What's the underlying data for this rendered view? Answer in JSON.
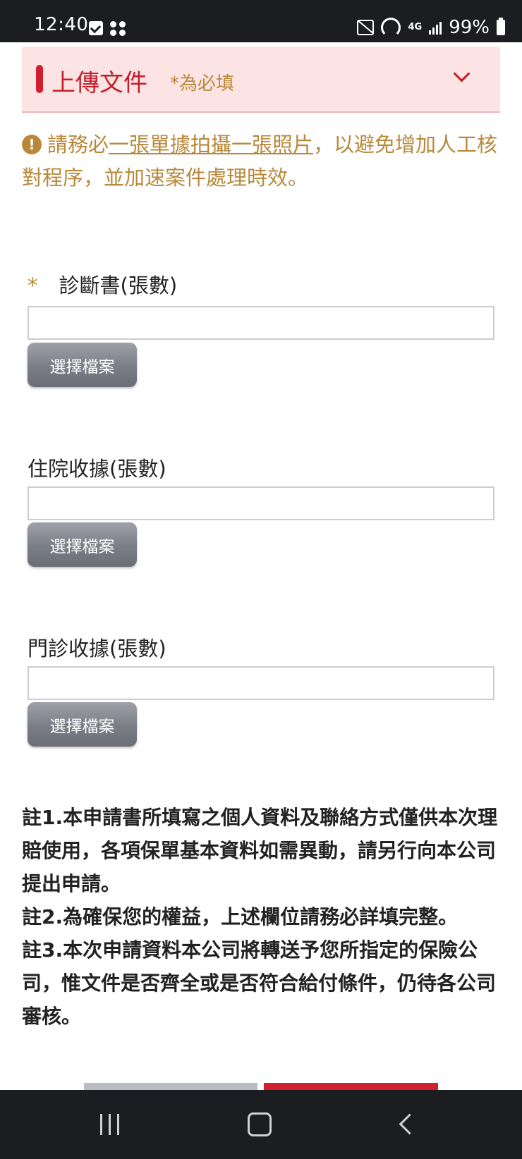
{
  "status_bar": {
    "time": "12:40",
    "network": "4G",
    "battery": "99%"
  },
  "section": {
    "title": "上傳文件",
    "required_note": "*為必填"
  },
  "notice": {
    "prefix": "請務必",
    "emphasis": "一張單據拍攝一張照片",
    "suffix": "，以避免增加人工核對程序，並加速案件處理時效。"
  },
  "fields": [
    {
      "required_mark": "*",
      "label": "診斷書(張數)",
      "value": "",
      "button_label": "選擇檔案"
    },
    {
      "label": "住院收據(張數)",
      "value": "",
      "button_label": "選擇檔案"
    },
    {
      "label": "門診收據(張數)",
      "value": "",
      "button_label": "選擇檔案"
    }
  ],
  "notes": [
    "註1.本申請書所填寫之個人資料及聯絡方式僅供本次理賠使用，各項保單基本資料如需異動，請另行向本公司提出申請。",
    "註2.為確保您的權益，上述欄位請務必詳填完整。",
    "註3.本次申請資料本公司將轉送予您所指定的保險公司，惟文件是否齊全或是否符合給付條件，仍待各公司審核。"
  ],
  "colors": {
    "brand_red": "#d01f2e",
    "header_bg": "#fde4e4",
    "notice_gold": "#b8893b"
  }
}
